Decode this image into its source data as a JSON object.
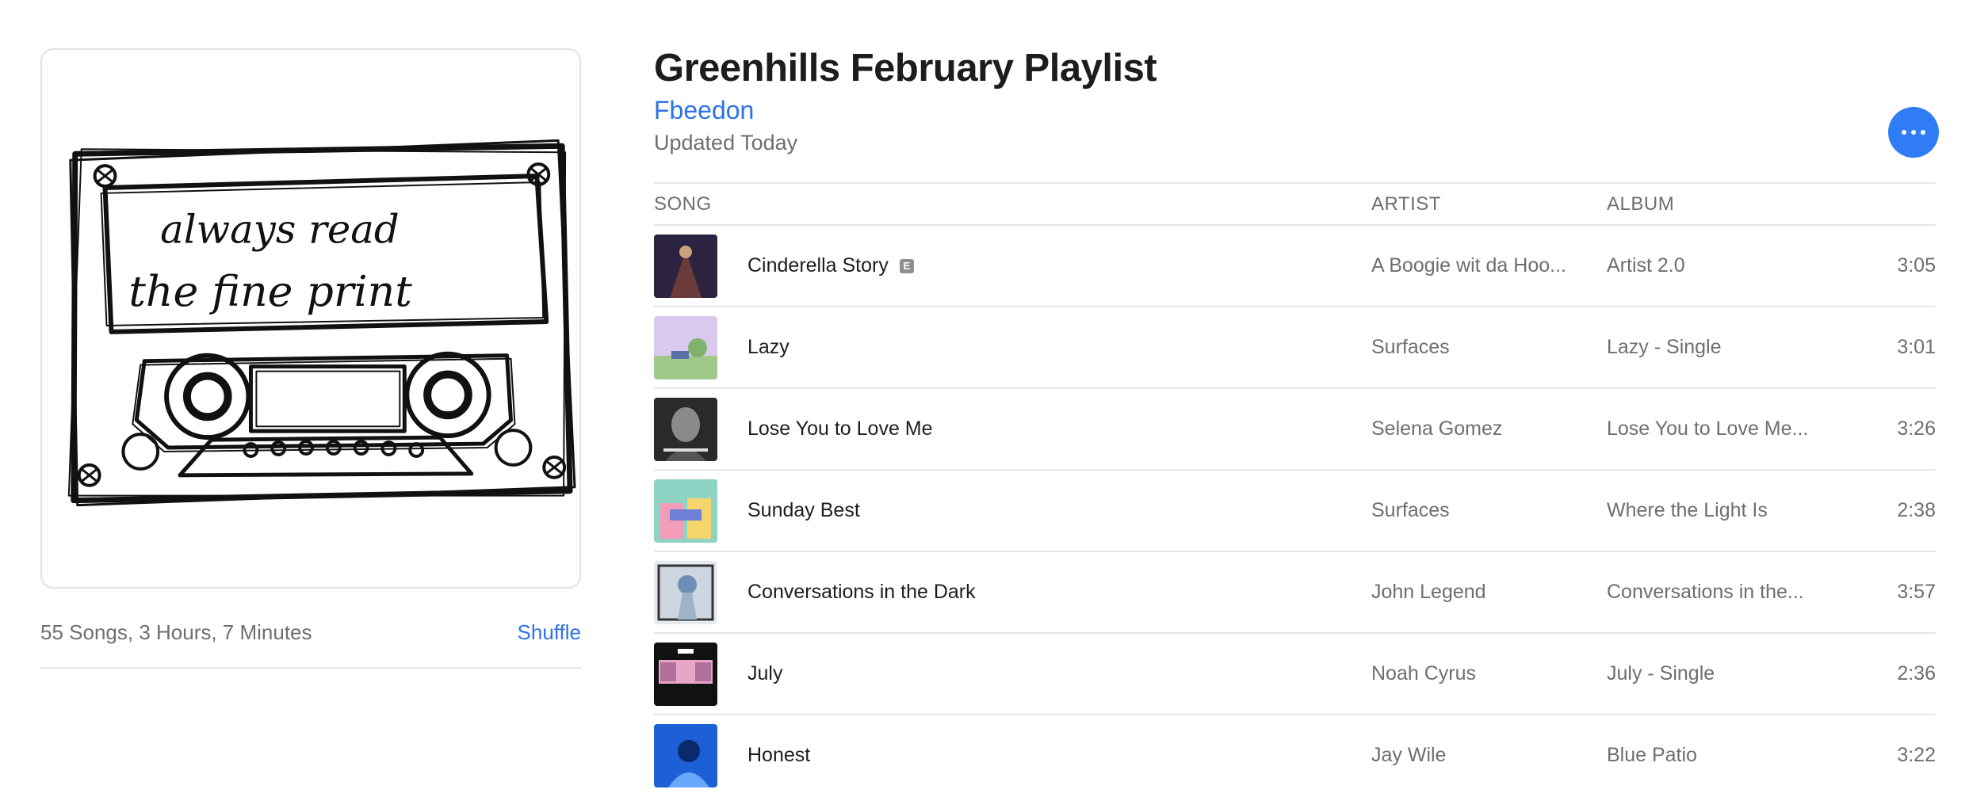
{
  "playlist": {
    "title": "Greenhills February Playlist",
    "curator": "Fbeedon",
    "updated": "Updated Today",
    "summary": "55 Songs, 3 Hours, 7 Minutes",
    "shuffle_label": "Shuffle",
    "artwork_text_line1": "always read",
    "artwork_text_line2": "the fine print"
  },
  "columns": {
    "song": "SONG",
    "artist": "ARTIST",
    "album": "ALBUM"
  },
  "explicit_badge": "E",
  "accent_color": "#2f7cf6",
  "tracks": [
    {
      "song": "Cinderella Story",
      "explicit": true,
      "artist": "A Boogie wit da Hoo...",
      "album": "Artist 2.0",
      "duration": "3:05",
      "cover_colors": [
        "#2b2340",
        "#6b3b3a"
      ]
    },
    {
      "song": "Lazy",
      "explicit": false,
      "artist": "Surfaces",
      "album": "Lazy - Single",
      "duration": "3:01",
      "cover_colors": [
        "#cdb8e6",
        "#9ec98a"
      ]
    },
    {
      "song": "Lose You to Love Me",
      "explicit": false,
      "artist": "Selena Gomez",
      "album": "Lose You to Love Me...",
      "duration": "3:26",
      "cover_colors": [
        "#2a2a2a",
        "#8a8a8a"
      ]
    },
    {
      "song": "Sunday Best",
      "explicit": false,
      "artist": "Surfaces",
      "album": "Where the Light Is",
      "duration": "2:38",
      "cover_colors": [
        "#8fd3c4",
        "#f29cb8"
      ]
    },
    {
      "song": "Conversations in the Dark",
      "explicit": false,
      "artist": "John Legend",
      "album": "Conversations in the...",
      "duration": "3:57",
      "cover_colors": [
        "#d6dde6",
        "#6d8eb5"
      ]
    },
    {
      "song": "July",
      "explicit": false,
      "artist": "Noah Cyrus",
      "album": "July - Single",
      "duration": "2:36",
      "cover_colors": [
        "#111111",
        "#e7a6c7"
      ]
    },
    {
      "song": "Honest",
      "explicit": false,
      "artist": "Jay Wile",
      "album": "Blue Patio",
      "duration": "3:22",
      "cover_colors": [
        "#1d5fd6",
        "#6aa8ff"
      ]
    }
  ]
}
